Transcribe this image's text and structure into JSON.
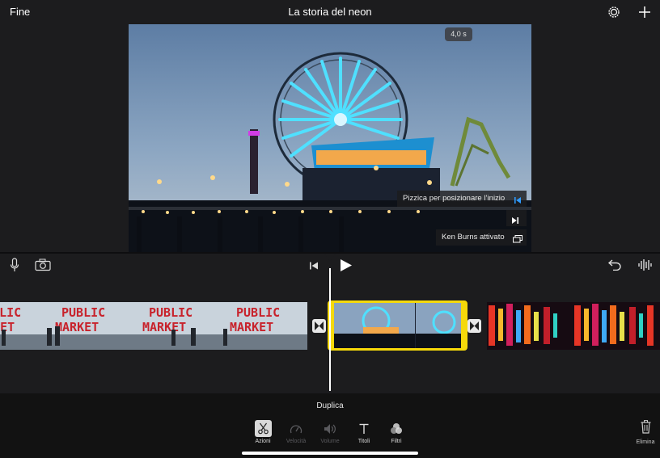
{
  "header": {
    "done_label": "Fine",
    "project_title": "La storia del neon",
    "settings_icon": "gear-icon",
    "add_icon": "plus-icon"
  },
  "viewer": {
    "clip_duration": "4,0 s",
    "ken_burns_start_hint": "Pizzica per posizionare l’inizio",
    "ken_burns_status": "Ken Burns attivato",
    "accent_color": "#2f9bff"
  },
  "controls": {
    "microphone_icon": "microphone-icon",
    "camera_icon": "camera-icon",
    "skip_back_icon": "skip-to-start-icon",
    "play_icon": "play-icon",
    "undo_icon": "undo-icon",
    "audio_icon": "waveform-icon"
  },
  "timeline": {
    "clips": [
      "public-market",
      "ferris-wheel",
      "neon-signs"
    ],
    "selected_clip_color": "#f5d90a"
  },
  "inspector": {
    "action_title": "Duplica",
    "tools": [
      {
        "label": "Azioni",
        "icon": "scissors-icon",
        "enabled": true
      },
      {
        "label": "Velocità",
        "icon": "speedometer-icon",
        "enabled": false
      },
      {
        "label": "Volume",
        "icon": "speaker-icon",
        "enabled": false
      },
      {
        "label": "Titoli",
        "icon": "text-icon",
        "enabled": true
      },
      {
        "label": "Filtri",
        "icon": "filters-icon",
        "enabled": true
      }
    ],
    "delete_label": "Elimina"
  }
}
